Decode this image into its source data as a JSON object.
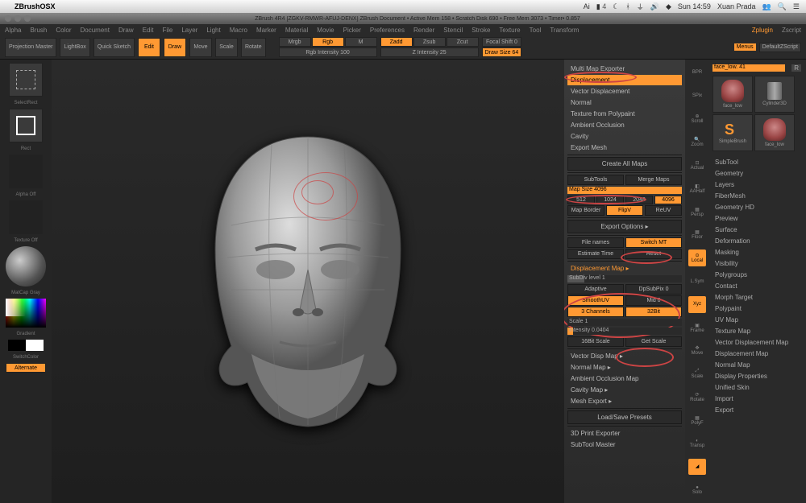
{
  "mac": {
    "app": "ZBrushOSX",
    "clock": "Sun 14:59",
    "user": "Xuan Prada",
    "bat": "4"
  },
  "title": "ZBrush 4R4 [ZGKV-RMWR-AFUJ-DENX]    ZBrush Document  • Active Mem 158 • Scratch Disk 690 • Free Mem 3073 • Timer• 0.857",
  "menubar": [
    "Alpha",
    "Brush",
    "Color",
    "Document",
    "Draw",
    "Edit",
    "File",
    "Layer",
    "Light",
    "Macro",
    "Marker",
    "Material",
    "Movie",
    "Picker",
    "Preferences",
    "Render",
    "Stencil",
    "Stroke",
    "Texture",
    "Tool",
    "Transform"
  ],
  "menubar_active": [
    "Zplugin",
    "Zscript"
  ],
  "topbar": {
    "proj": "Projection Master",
    "lightbox": "LightBox",
    "quick": "Quick Sketch",
    "edit": "Edit",
    "draw": "Draw",
    "move": "Move",
    "scale": "Scale",
    "rotate": "Rotate",
    "mrgb": "Mrgb",
    "rgb": "Rgb",
    "m": "M",
    "rgbint": "Rgb Intensity 100",
    "zadd": "Zadd",
    "zsub": "Zsub",
    "zcut": "Zcut",
    "zint": "Z Intensity 25",
    "fshift": "Focal Shift 0",
    "dsize": "Draw Size 64"
  },
  "left": {
    "selectrect": "SelectRect",
    "rect": "Rect",
    "alphaoff": "Alpha Off",
    "textureoff": "Texture Off",
    "matcap": "MatCap Gray",
    "gradient": "Gradient",
    "switch": "SwitchColor",
    "alternate": "Alternate"
  },
  "zplugin": {
    "multi": "Multi Map Exporter",
    "disp": "Displacement",
    "vdisp": "Vector Displacement",
    "normal": "Normal",
    "texpoly": "Texture from Polypaint",
    "ao": "Ambient Occlusion",
    "cavity": "Cavity",
    "expmesh": "Export Mesh",
    "createall": "Create All Maps",
    "subtools": "SubTools",
    "merge": "Merge Maps",
    "mapsize": "Map Size 4096",
    "sizes": [
      "512",
      "1024",
      "2048",
      "4096"
    ],
    "border": "Map Border",
    "flipv": "FlipV",
    "reuv": "ReUV",
    "expopt": "Export Options  ▸",
    "filenames": "File names",
    "switchmt": "Switch MT",
    "esttime": "Estimate Time",
    "reset": "Reset",
    "dispmap": "Displacement Map  ▸",
    "subdiv": "SubDiv level 1",
    "adaptive": "Adaptive",
    "dpsub": "DpSubPix 0",
    "smoothuv": "SmoothUV",
    "mid": "Mid 0",
    "ch3": "3 Channels",
    "bit32": "32Bit",
    "scale": "Scale 1",
    "intensity": "Intensity 0.0404",
    "bit16": "16Bit Scale",
    "getscale": "Get Scale",
    "vdm": "Vector Disp Map  ▸",
    "nmap": "Normal Map  ▸",
    "aomap": "Ambient Occlusion Map",
    "cavmap": "Cavity Map  ▸",
    "meshexp": "Mesh Export  ▸",
    "loadsave": "Load/Save Presets",
    "print3d": "3D Print Exporter",
    "stmaster": "SubTool Master"
  },
  "strip": [
    "BPR",
    "SPix",
    "Scroll",
    "Zoom",
    "Actual",
    "AAHalf",
    "Persp",
    "Floor",
    "Local",
    "L.Sym",
    "Xyz",
    "Frame",
    "Move",
    "Scale",
    "Rotate",
    "PolyF",
    "Transp",
    "",
    "Solo"
  ],
  "right": {
    "menus": "Menus",
    "default": "DefaultZScript",
    "tool": "face_low. 41",
    "r": "R",
    "thumbs": [
      "face_low",
      "Cylinder3D",
      "SimpleBrush",
      "face_low"
    ],
    "palettes": [
      "SubTool",
      "Geometry",
      "Layers",
      "FiberMesh",
      "Geometry HD",
      "Preview",
      "Surface",
      "Deformation",
      "Masking",
      "Visibility",
      "Polygroups",
      "Contact",
      "Morph Target",
      "Polypaint",
      "UV Map",
      "Texture Map",
      "Vector Displacement Map",
      "Displacement Map",
      "Normal Map",
      "Display Properties",
      "Unified Skin",
      "Import",
      "Export"
    ]
  }
}
